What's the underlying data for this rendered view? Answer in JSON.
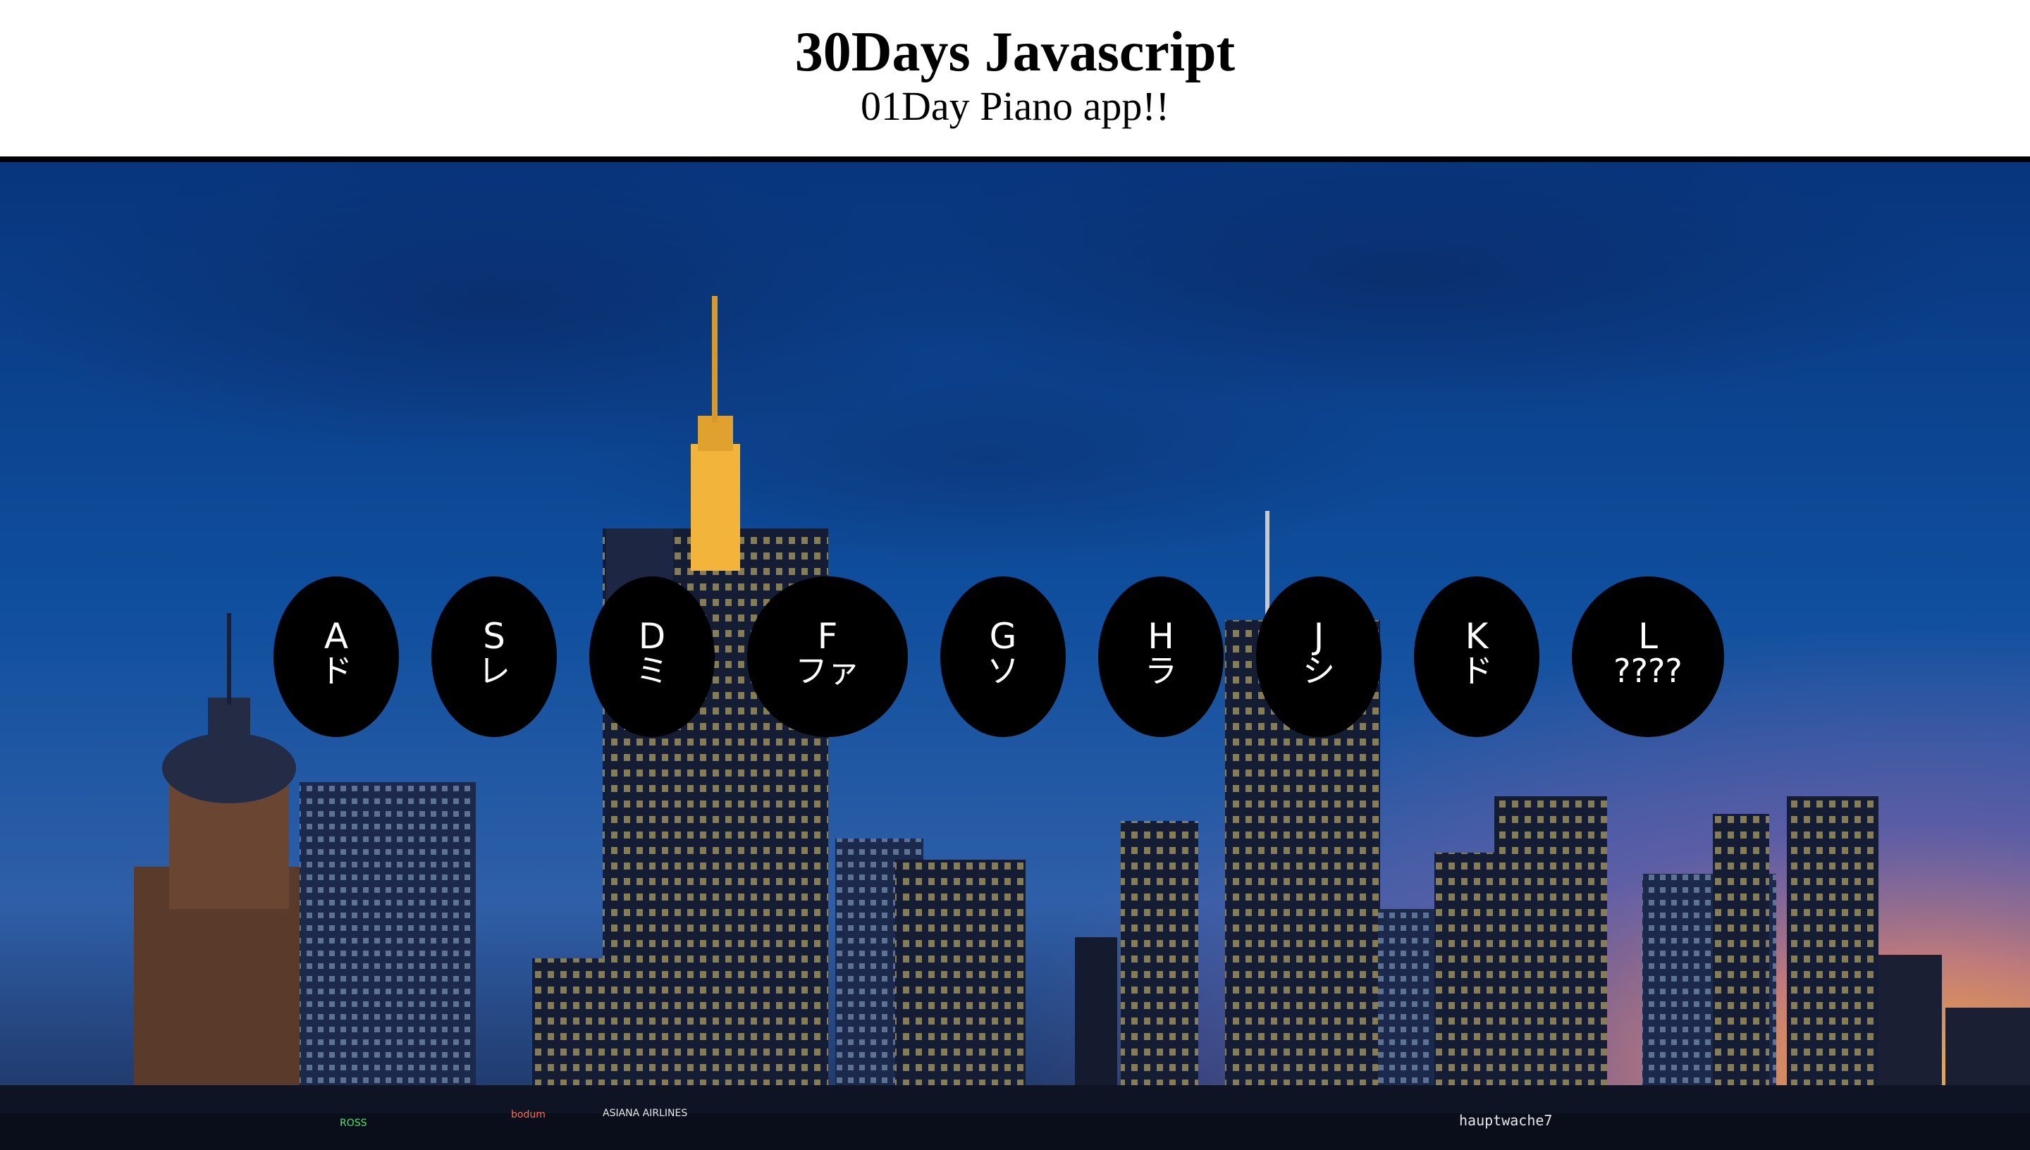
{
  "header": {
    "title": "30Days Javascript",
    "subtitle": "01Day Piano app!!"
  },
  "keys": [
    {
      "letter": "A",
      "note": "ド"
    },
    {
      "letter": "S",
      "note": "レ"
    },
    {
      "letter": "D",
      "note": "ミ"
    },
    {
      "letter": "F",
      "note": "ファ"
    },
    {
      "letter": "G",
      "note": "ソ"
    },
    {
      "letter": "H",
      "note": "ラ"
    },
    {
      "letter": "J",
      "note": "シ"
    },
    {
      "letter": "K",
      "note": "ド"
    },
    {
      "letter": "L",
      "note": "????"
    }
  ],
  "background": {
    "signs": [
      "hauptwache7",
      "ASIANA AIRLINES",
      "bodum",
      "ROSS"
    ]
  },
  "colors": {
    "key_bg": "#000000",
    "key_text": "#ffffff",
    "sky_top": "#0b3a86",
    "sky_horizon": "#8a5fa6",
    "sunset": "#f2a23a"
  }
}
